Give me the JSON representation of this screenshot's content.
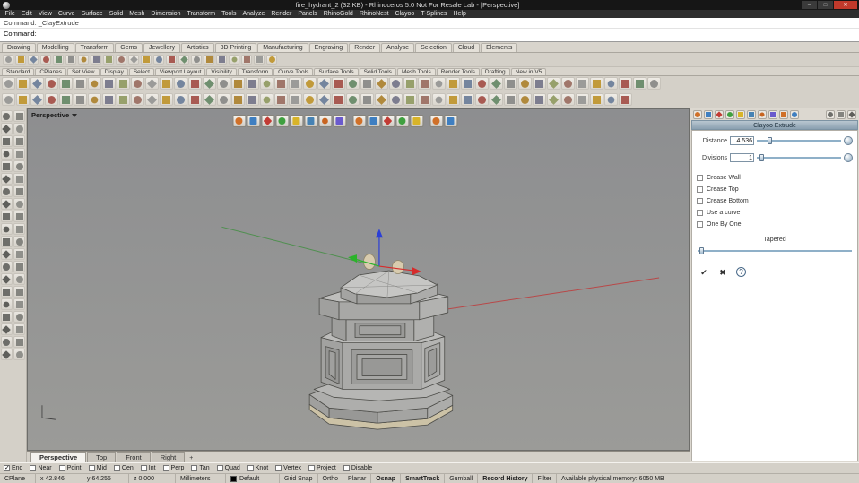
{
  "window": {
    "title": "fire_hydrant_2 (32 KB) - Rhinoceros 5.0 Not For Resale Lab - [Perspective]",
    "controls": {
      "minimize": "–",
      "maximize": "□",
      "close": "✕"
    }
  },
  "menubar": {
    "items": [
      "File",
      "Edit",
      "View",
      "Curve",
      "Surface",
      "Solid",
      "Mesh",
      "Dimension",
      "Transform",
      "Tools",
      "Analyze",
      "Render",
      "Panels",
      "RhinoGold",
      "RhinoNest",
      "Clayoo",
      "T-Splines",
      "Help"
    ]
  },
  "command": {
    "history": "Command: _ClayExtrude",
    "prompt_label": "Command:"
  },
  "ribbon_tabs": {
    "items": [
      "Drawing",
      "Modelling",
      "Transform",
      "Gems",
      "Jewellery",
      "Artistics",
      "3D Printing",
      "Manufacturing",
      "Engraving",
      "Render",
      "Analyse",
      "Selection",
      "Cloud",
      "Elements"
    ]
  },
  "toolbar_tabs": {
    "items": [
      "Standard",
      "CPlanes",
      "Set View",
      "Display",
      "Select",
      "Viewport Layout",
      "Visibility",
      "Transform",
      "Curve Tools",
      "Surface Tools",
      "Solid Tools",
      "Mesh Tools",
      "Render Tools",
      "Drafting",
      "New in V5"
    ]
  },
  "viewport": {
    "label": "Perspective",
    "add_tab_label": "+",
    "tabs": [
      {
        "label": "Perspective",
        "active": true
      },
      {
        "label": "Top",
        "active": false
      },
      {
        "label": "Front",
        "active": false
      },
      {
        "label": "Right",
        "active": false
      }
    ]
  },
  "panel": {
    "title": "Clayoo Extrude",
    "fields": [
      {
        "label": "Distance",
        "value": "4.536"
      },
      {
        "label": "Divisions",
        "value": "1"
      }
    ],
    "checkboxes": [
      {
        "label": "Crease Wall",
        "checked": false
      },
      {
        "label": "Crease Top",
        "checked": false
      },
      {
        "label": "Crease Bottom",
        "checked": false
      },
      {
        "label": "Use a curve",
        "checked": false
      },
      {
        "label": "One By One",
        "checked": false
      }
    ],
    "tapered_label": "Tapered",
    "buttons": {
      "accept": "✔",
      "cancel": "✖",
      "help": "?"
    }
  },
  "osnap": {
    "items": [
      {
        "label": "End",
        "checked": true
      },
      {
        "label": "Near",
        "checked": false
      },
      {
        "label": "Point",
        "checked": false
      },
      {
        "label": "Mid",
        "checked": false
      },
      {
        "label": "Cen",
        "checked": false
      },
      {
        "label": "Int",
        "checked": false
      },
      {
        "label": "Perp",
        "checked": false
      },
      {
        "label": "Tan",
        "checked": false
      },
      {
        "label": "Quad",
        "checked": false
      },
      {
        "label": "Knot",
        "checked": false
      },
      {
        "label": "Vertex",
        "checked": false
      },
      {
        "label": "Project",
        "checked": false
      },
      {
        "label": "Disable",
        "checked": false
      }
    ]
  },
  "statusbar": {
    "cplane_label": "CPlane",
    "x": "x 42.846",
    "y": "y 64.255",
    "z": "z 0.000",
    "units": "Millimeters",
    "layer": "Default",
    "toggles": [
      {
        "label": "Grid Snap",
        "active": false
      },
      {
        "label": "Ortho",
        "active": false
      },
      {
        "label": "Planar",
        "active": false
      },
      {
        "label": "Osnap",
        "active": true
      },
      {
        "label": "SmartTrack",
        "active": true
      },
      {
        "label": "Gumball",
        "active": false
      },
      {
        "label": "Record History",
        "active": true
      },
      {
        "label": "Filter",
        "active": false
      }
    ],
    "memory": "Available physical memory: 6050 MB"
  },
  "icon_counts": {
    "toolbar_small": 22,
    "row_a": 46,
    "row_b": 44,
    "left_palette": 40,
    "vp_group1": 8,
    "vp_group2": 5,
    "vp_group3": 2,
    "panel_tabs": 10,
    "panel_tab_right": 3
  },
  "colors": {
    "close_button": "#c0392b",
    "viewport_bg": "#929292",
    "gumball_x": "#d62b2b",
    "gumball_y": "#2bb32b",
    "gumball_z": "#2b3fd6",
    "cplane_x_axis": "#b84848",
    "cplane_y_axis": "#4e8f4e",
    "clay_material": "#d8cbae"
  }
}
